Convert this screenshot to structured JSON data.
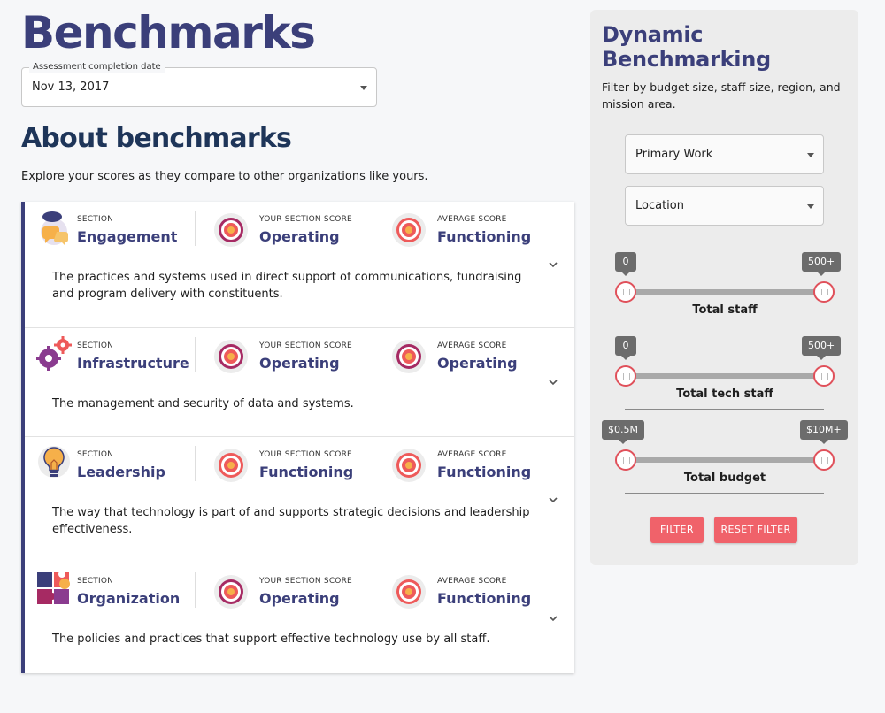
{
  "page": {
    "title": "Benchmarks"
  },
  "date_field": {
    "legend": "Assessment completion date",
    "value": "Nov 13, 2017"
  },
  "about": {
    "title": "About benchmarks",
    "description": "Explore your scores as they compare to other organizations like yours."
  },
  "labels": {
    "section": "SECTION",
    "your_score": "YOUR SECTION SCORE",
    "average_score": "AVERAGE SCORE"
  },
  "sections": [
    {
      "name": "Engagement",
      "icon": "speech-bubbles-icon",
      "your_score": "Operating",
      "average_score": "Functioning",
      "description": "The practices and systems used in direct support of communications, fundraising and program delivery with constituents."
    },
    {
      "name": "Infrastructure",
      "icon": "gears-icon",
      "your_score": "Operating",
      "average_score": "Operating",
      "description": "The management and security of data and systems."
    },
    {
      "name": "Leadership",
      "icon": "lightbulb-icon",
      "your_score": "Functioning",
      "average_score": "Functioning",
      "description": "The way that technology is part of and supports strategic decisions and leadership effectiveness."
    },
    {
      "name": "Organization",
      "icon": "puzzle-icon",
      "your_score": "Operating",
      "average_score": "Functioning",
      "description": "The policies and practices that support effective technology use by all staff."
    }
  ],
  "side_panel": {
    "title": "Dynamic Benchmarking",
    "description": "Filter by budget size, staff size, region, and mission area.",
    "select_primary_work": "Primary Work",
    "select_location": "Location",
    "sliders": [
      {
        "label": "Total staff",
        "min_label": "0",
        "max_label": "500+"
      },
      {
        "label": "Total tech staff",
        "min_label": "0",
        "max_label": "500+"
      },
      {
        "label": "Total budget",
        "min_label": "$0.5M",
        "max_label": "$10M+"
      }
    ],
    "filter_button": "FILTER",
    "reset_button": "RESET FILTER"
  },
  "colors": {
    "brand": "#3b3f7a",
    "heading": "#1e3559",
    "accent": "#f0626a"
  }
}
